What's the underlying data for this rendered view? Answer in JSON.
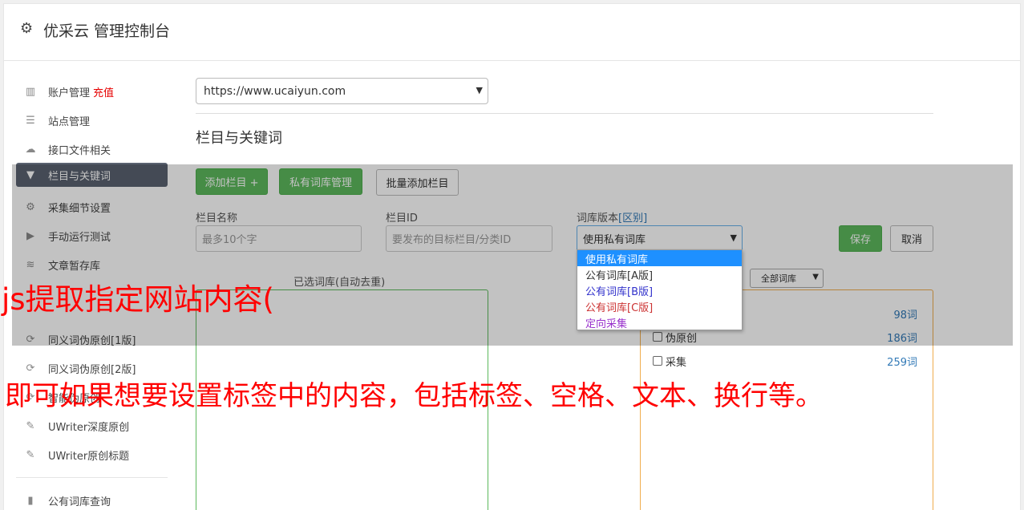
{
  "header": {
    "icon": "gear-icon",
    "title": "优采云 管理控制台"
  },
  "sidebar": {
    "items": [
      {
        "icon": "bar-chart-icon",
        "glyph": "▥",
        "label": "账户管理",
        "extra": "充值"
      },
      {
        "icon": "server-icon",
        "glyph": "☰",
        "label": "站点管理"
      },
      {
        "icon": "cloud-upload-icon",
        "glyph": "☁",
        "label": "接口文件相关"
      },
      {
        "icon": "filter-icon",
        "glyph": "▼",
        "label": "栏目与关键词",
        "active": true
      },
      {
        "icon": "gears-icon",
        "glyph": "⚙",
        "label": "采集细节设置"
      },
      {
        "icon": "play-circle-icon",
        "glyph": "▶",
        "label": "手动运行测试"
      },
      {
        "icon": "database-icon",
        "glyph": "≋",
        "label": "文章暂存库"
      },
      {
        "icon": "refresh-icon",
        "glyph": "⟳",
        "label": "同义词伪原创[1版]"
      },
      {
        "icon": "refresh-icon",
        "glyph": "⟳",
        "label": "同义词伪原创[2版]"
      },
      {
        "icon": "refresh-icon",
        "glyph": "⟳",
        "label": "智能伪原创"
      },
      {
        "icon": "edit-icon",
        "glyph": "✎",
        "label": "UWriter深度原创"
      },
      {
        "icon": "edit-icon",
        "glyph": "✎",
        "label": "UWriter原创标题"
      },
      {
        "icon": "book-icon",
        "glyph": "▮",
        "label": "公有词库查询"
      }
    ]
  },
  "main": {
    "site_select": "https://www.ucaiyun.com",
    "section_title": "栏目与关键词",
    "buttons": {
      "add_column": "添加栏目 +",
      "private_lib": "私有词库管理",
      "bulk_add": "批量添加栏目",
      "save": "保存",
      "cancel": "取消"
    },
    "fields": {
      "name_label": "栏目名称",
      "name_placeholder": "最多10个字",
      "id_label": "栏目ID",
      "id_placeholder": "要发布的目标栏目/分类ID",
      "version_label": "词库版本",
      "version_link": "[区别]",
      "version_value": "使用私有词库"
    },
    "dropdown": {
      "options": [
        {
          "label": "使用私有词库",
          "color": "#ffffff",
          "selected": true
        },
        {
          "label": "公有词库[A版]",
          "color": "#333333"
        },
        {
          "label": "公有词库[B版]",
          "color": "#3333cc"
        },
        {
          "label": "公有词库[C版]",
          "color": "#cc3333"
        },
        {
          "label": "定向采集",
          "color": "#9933cc"
        }
      ]
    },
    "selected_lib_label": "已选词库(自动去重)",
    "lib_filter": "全部词库",
    "libs": [
      {
        "label": "",
        "count": "98词"
      },
      {
        "label": "伪原创",
        "count": "186词"
      },
      {
        "label": "采集",
        "count": "259词"
      }
    ]
  },
  "watermark": {
    "line1": "js提取指定网站内容(",
    "line2": "即可如果想要设置标签中的内容，包括标签、空格、文本、换行等。"
  }
}
